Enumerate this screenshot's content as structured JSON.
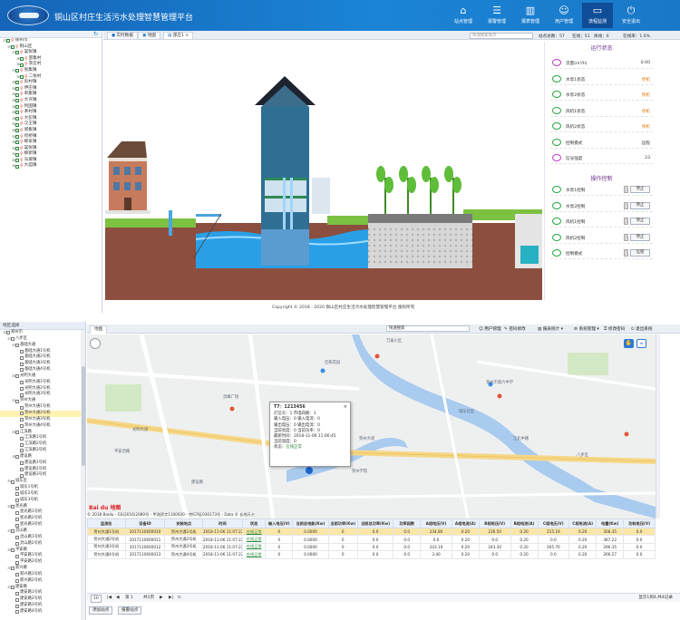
{
  "top": {
    "header": {
      "title": "铜山区村庄生活污水处理智慧管理平台",
      "nav": [
        {
          "label": "站点管理",
          "icon": "building-icon"
        },
        {
          "label": "报警管理",
          "icon": "database-icon"
        },
        {
          "label": "报表管理",
          "icon": "chart-icon"
        },
        {
          "label": "用户管理",
          "icon": "users-icon"
        },
        {
          "label": "流程监测",
          "icon": "monitor-icon"
        },
        {
          "label": "安全退出",
          "icon": "exit-icon"
        }
      ]
    },
    "tree": {
      "refresh_icon": "refresh-icon",
      "nodes": [
        {
          "label": "徐州市",
          "level": 0,
          "exp": "⊟"
        },
        {
          "label": "铜山区",
          "level": 1,
          "exp": "⊟"
        },
        {
          "label": "棠张镇",
          "level": 2,
          "exp": "⊟"
        },
        {
          "label": "邵集村",
          "level": 3,
          "exp": "⊞"
        },
        {
          "label": "李庄村",
          "level": 3,
          "exp": "⊞"
        },
        {
          "label": "张集镇",
          "level": 2,
          "exp": "⊟"
        },
        {
          "label": "二张村",
          "level": 3,
          "exp": "⊞"
        },
        {
          "label": "房村镇",
          "level": 2,
          "exp": "⊞"
        },
        {
          "label": "伊庄镇",
          "level": 2,
          "exp": "⊞"
        },
        {
          "label": "单集镇",
          "level": 2,
          "exp": "⊞"
        },
        {
          "label": "大许镇",
          "level": 2,
          "exp": "⊞"
        },
        {
          "label": "利国镇",
          "level": 2,
          "exp": "⊞"
        },
        {
          "label": "茅村镇",
          "level": 2,
          "exp": "⊞"
        },
        {
          "label": "大彭镇",
          "level": 2,
          "exp": "⊞"
        },
        {
          "label": "汉王镇",
          "level": 2,
          "exp": "⊞"
        },
        {
          "label": "郑集镇",
          "level": 2,
          "exp": "⊞"
        },
        {
          "label": "何桥镇",
          "level": 2,
          "exp": "⊞"
        },
        {
          "label": "柳泉镇",
          "level": 2,
          "exp": "⊞"
        },
        {
          "label": "棠张镇",
          "level": 2,
          "exp": "⊞"
        },
        {
          "label": "柳新镇",
          "level": 2,
          "exp": "⊞"
        },
        {
          "label": "马坡镇",
          "level": 2,
          "exp": "⊞"
        },
        {
          "label": "大庙镇",
          "level": 2,
          "exp": "⊞"
        }
      ]
    },
    "tabs": [
      {
        "label": "实时数据"
      },
      {
        "label": "地图"
      },
      {
        "label": "邵庄1 ×"
      }
    ],
    "search": {
      "placeholder": "快速搜索站点"
    },
    "stats": [
      {
        "label": "站点总数：57"
      },
      {
        "label": "在线：51"
      },
      {
        "label": "离线：6"
      },
      {
        "label": "在线率：1.6%"
      }
    ],
    "status_panel": {
      "title": "运行状态",
      "rows": [
        {
          "label": "流量(m³/h)",
          "value": "0.00",
          "warn": false,
          "color": "pink"
        },
        {
          "label": "水泵1状态",
          "value": "停机",
          "warn": true,
          "color": "green"
        },
        {
          "label": "水泵2状态",
          "value": "停机",
          "warn": true,
          "color": "green"
        },
        {
          "label": "风机1状态",
          "value": "停机",
          "warn": true,
          "color": "green"
        },
        {
          "label": "风机2状态",
          "value": "停机",
          "warn": true,
          "color": "green"
        },
        {
          "label": "控制模式",
          "value": "远程",
          "warn": false,
          "color": "green"
        },
        {
          "label": "信号强度",
          "value": "23",
          "warn": false,
          "color": "pink"
        }
      ]
    },
    "control_panel": {
      "title": "操作控制",
      "rows": [
        {
          "label": "水泵1控制",
          "button": "停止"
        },
        {
          "label": "水泵2控制",
          "button": "停止"
        },
        {
          "label": "风机1控制",
          "button": "停止"
        },
        {
          "label": "风机2控制",
          "button": "停止"
        },
        {
          "label": "控制模式",
          "button": "远程"
        }
      ]
    },
    "copyright": "Copyright © 2018 - 2020 铜山区村庄生活污水处理智慧管理平台 版权所有"
  },
  "bottom": {
    "tree": {
      "title": "地区选择",
      "nodes": [
        {
          "label": "郑州市",
          "level": 0,
          "exp": "⊟",
          "sel": false
        },
        {
          "label": "八步区",
          "level": 1,
          "exp": "⊟",
          "sel": false
        },
        {
          "label": "基础大通",
          "level": 2,
          "exp": "⊟",
          "sel": false
        },
        {
          "label": "基础大通1号机",
          "level": 3,
          "exp": "",
          "sel": false
        },
        {
          "label": "基础大通2号机",
          "level": 3,
          "exp": "",
          "sel": false
        },
        {
          "label": "基础大通3号机",
          "level": 3,
          "exp": "",
          "sel": false
        },
        {
          "label": "基础大通4号机",
          "level": 3,
          "exp": "",
          "sel": false
        },
        {
          "label": "光明大通",
          "level": 2,
          "exp": "⊟",
          "sel": false
        },
        {
          "label": "光明大通1号机",
          "level": 3,
          "exp": "",
          "sel": false
        },
        {
          "label": "光明大通2号机",
          "level": 3,
          "exp": "",
          "sel": false
        },
        {
          "label": "光明大通3号机",
          "level": 3,
          "exp": "",
          "sel": false
        },
        {
          "label": "贺州大通",
          "level": 2,
          "exp": "⊟",
          "sel": false
        },
        {
          "label": "贺州大通1号机",
          "level": 3,
          "exp": "",
          "sel": false
        },
        {
          "label": "贺州大通2号机",
          "level": 3,
          "exp": "",
          "sel": true
        },
        {
          "label": "贺州大通3号机",
          "level": 3,
          "exp": "",
          "sel": false
        },
        {
          "label": "贺州大通4号机",
          "level": 3,
          "exp": "",
          "sel": false
        },
        {
          "label": "江滨路",
          "level": 2,
          "exp": "⊟",
          "sel": false
        },
        {
          "label": "江滨路1号机",
          "level": 3,
          "exp": "",
          "sel": false
        },
        {
          "label": "江滨路2号机",
          "level": 3,
          "exp": "",
          "sel": false
        },
        {
          "label": "江滨路3号机",
          "level": 3,
          "exp": "",
          "sel": false
        },
        {
          "label": "建设路",
          "level": 2,
          "exp": "⊟",
          "sel": false
        },
        {
          "label": "建设路1号机",
          "level": 3,
          "exp": "",
          "sel": false
        },
        {
          "label": "建设路2号机",
          "level": 3,
          "exp": "",
          "sel": false
        },
        {
          "label": "建设路3号机",
          "level": 3,
          "exp": "",
          "sel": false
        },
        {
          "label": "城东区",
          "level": 1,
          "exp": "⊟",
          "sel": false
        },
        {
          "label": "城东1号机",
          "level": 2,
          "exp": "",
          "sel": false
        },
        {
          "label": "城东2号机",
          "level": 2,
          "exp": "",
          "sel": false
        },
        {
          "label": "城东3号机",
          "level": 2,
          "exp": "",
          "sel": false
        },
        {
          "label": "星光路",
          "level": 1,
          "exp": "⊟",
          "sel": false
        },
        {
          "label": "星光路1号机",
          "level": 2,
          "exp": "",
          "sel": false
        },
        {
          "label": "星光路2号机",
          "level": 2,
          "exp": "",
          "sel": false
        },
        {
          "label": "星光路3号机",
          "level": 2,
          "exp": "",
          "sel": false
        },
        {
          "label": "灵山路",
          "level": 1,
          "exp": "⊟",
          "sel": false
        },
        {
          "label": "灵山路1号机",
          "level": 2,
          "exp": "",
          "sel": false
        },
        {
          "label": "灵山路2号机",
          "level": 2,
          "exp": "",
          "sel": false
        },
        {
          "label": "平安路",
          "level": 1,
          "exp": "⊟",
          "sel": false
        },
        {
          "label": "平安路1号机",
          "level": 2,
          "exp": "",
          "sel": false
        },
        {
          "label": "平安路2号机",
          "level": 2,
          "exp": "",
          "sel": false
        },
        {
          "label": "新兴路",
          "level": 1,
          "exp": "⊟",
          "sel": false
        },
        {
          "label": "新兴路1号机",
          "level": 2,
          "exp": "",
          "sel": false
        },
        {
          "label": "新兴路2号机",
          "level": 2,
          "exp": "",
          "sel": false
        },
        {
          "label": "建安路",
          "level": 1,
          "exp": "⊟",
          "sel": false
        },
        {
          "label": "建安路1号机",
          "level": 2,
          "exp": "",
          "sel": false
        },
        {
          "label": "建安路2号机",
          "level": 2,
          "exp": "",
          "sel": false
        },
        {
          "label": "建安路3号机",
          "level": 2,
          "exp": "",
          "sel": false
        },
        {
          "label": "建安路4号机",
          "level": 2,
          "exp": "",
          "sel": false
        }
      ]
    },
    "tab": "地图",
    "search_value": "快速搜索",
    "tools": [
      {
        "label": "用户管理",
        "icon": "user-icon"
      },
      {
        "label": "密码修改",
        "icon": "pencil-icon"
      },
      {
        "label": "报表统计 ▾",
        "icon": "chart-icon"
      },
      {
        "label": "系统管理 ▾",
        "icon": "gear-icon"
      },
      {
        "label": "修改密码",
        "icon": "lock-icon"
      },
      {
        "label": "退出系统",
        "icon": "exit-icon"
      }
    ],
    "map": {
      "labels": [
        "万泰小区",
        "佳和花园",
        "贺州市第六中学",
        "城东社区",
        "贺州大道",
        "灵峰广场",
        "平安西路",
        "贺州学院",
        "江北中路",
        "建设路",
        "光明大道",
        "八步区"
      ],
      "popup": {
        "title": "T7：1213456",
        "rows": [
          "灯信号：1  市电四路：1",
          "输入电压：0  输入电流：0",
          "输出电压：0  输出电流：0",
          "当前亮度：0  当前功率：0",
          "最新时间：2018-11-06 11:06:45",
          "当前温度：0"
        ],
        "status_label": "状态：",
        "status": "在线正常"
      },
      "credit": "© 2018 Baidu - GS(2016)2089号 - 甲测资字1100930 - 京ICP证030173号 - Data © 长地万方",
      "baidu": "Bai du 地图"
    },
    "table": {
      "headers": [
        "监测名",
        "设备ID",
        "安装地点",
        "时间",
        "状态",
        "输入电压(V)",
        "当前总电能(Kw)",
        "当前功率(Kw)",
        "当前总功率(Kw)",
        "功率因数",
        "A相电压(V)",
        "A相电流(A)",
        "B相电压(V)",
        "B相电流(A)",
        "C相电压(V)",
        "C相电流(A)",
        "电量(Kw)",
        "功耗电压(V)"
      ],
      "rows": [
        {
          "sel": true,
          "cells": [
            "贺州大通1号机",
            "2017110600010",
            "贺州大通1号机",
            "2018-11-06 11:07:22",
            "在线正常",
            "0",
            "0.0000",
            "0",
            "0.0",
            "0.0",
            "234.80",
            "0.20",
            "236.50",
            "0.20",
            "215.19",
            "0.20",
            "308.35",
            "0.0"
          ]
        },
        {
          "sel": false,
          "cells": [
            "贺州大通2号机",
            "2017110600011",
            "贺州大通2号机",
            "2018-11-06 11:07:22",
            "在线正常",
            "0",
            "0.0000",
            "0",
            "0.0",
            "0.0",
            "0.0",
            "0.20",
            "0.0",
            "0.20",
            "0.0",
            "0.20",
            "387.22",
            "0.0"
          ]
        },
        {
          "sel": false,
          "cells": [
            "贺州大通3号机",
            "2017110600012",
            "贺州大通3号机",
            "2018-11-06 11:07:22",
            "在线正常",
            "0",
            "0.0000",
            "0",
            "0.0",
            "0.0",
            "243.10",
            "0.20",
            "243.30",
            "0.20",
            "265.70",
            "0.20",
            "296.35",
            "0.0"
          ]
        },
        {
          "sel": false,
          "cells": [
            "贺州大通4号机",
            "2017110600013",
            "贺州大通4号机",
            "2018-11-06 11:07:22",
            "在线正常",
            "0",
            "0.0000",
            "0",
            "0.0",
            "0.0",
            "3.40",
            "0.20",
            "0.0",
            "0.20",
            "0.0",
            "0.20",
            "266.27",
            "0.0"
          ]
        }
      ]
    },
    "pager": {
      "page_size": "10",
      "page_label": "第 1",
      "total": "共1页",
      "info": "显示1到4,共4记录"
    },
    "footer": {
      "left_button": "添加站点",
      "right_button": "报警站点"
    }
  }
}
